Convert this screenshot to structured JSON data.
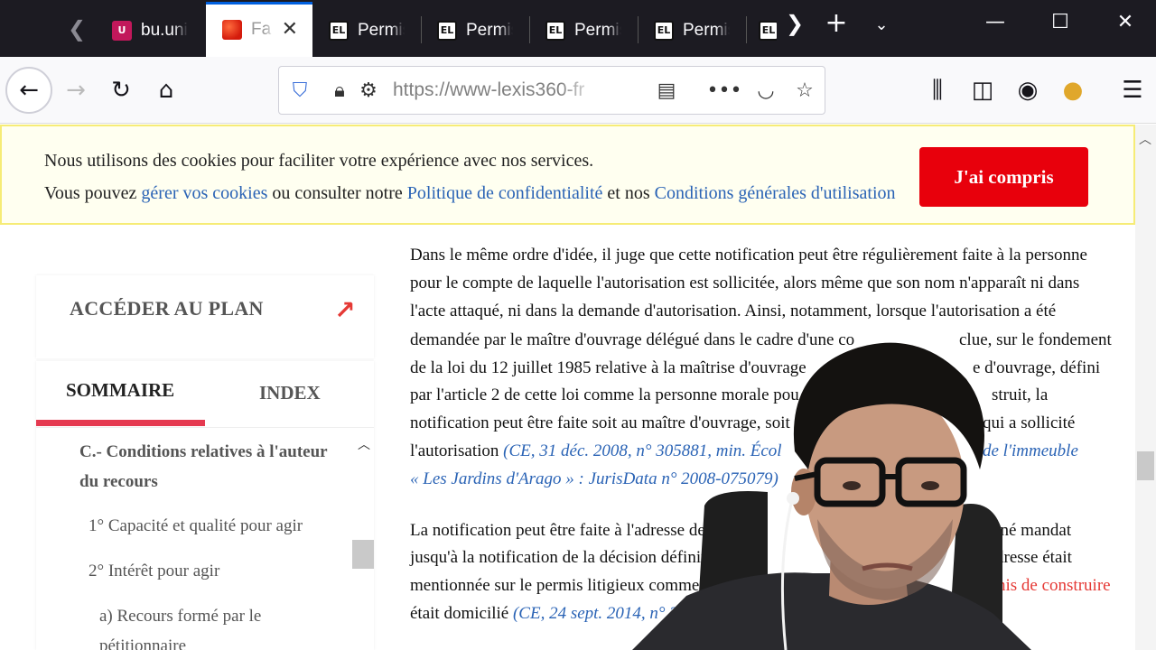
{
  "browser": {
    "tabs": [
      {
        "title": "bu.uni",
        "favicon": "U",
        "active": false
      },
      {
        "title": "Fa",
        "favicon": "",
        "active": true
      },
      {
        "title": "Permis",
        "favicon": "EL",
        "active": false
      },
      {
        "title": "Permis",
        "favicon": "EL",
        "active": false
      },
      {
        "title": "Permis",
        "favicon": "EL",
        "active": false
      },
      {
        "title": "Permis",
        "favicon": "EL",
        "active": false
      },
      {
        "title": "",
        "favicon": "EL",
        "active": false
      }
    ],
    "url": "https://www-lexis360-fr",
    "icons": {
      "back": "back-arrow-icon",
      "forward": "forward-arrow-icon",
      "reload": "reload-icon",
      "home": "home-icon",
      "shield": "tracking-shield-icon",
      "lock": "lock-icon",
      "permissions": "permissions-icon",
      "reader": "reader-view-icon",
      "more": "more-actions-icon",
      "pocket": "pocket-icon",
      "bookmark": "bookmark-star-icon",
      "library": "library-icon",
      "sidebar": "sidebar-icon",
      "account": "account-icon",
      "extension": "extension-icon",
      "menu": "hamburger-menu-icon"
    },
    "colors": {
      "tabbar": "#1c1b22",
      "active_tab_accent": "#0060df"
    }
  },
  "cookie_banner": {
    "line1": "Nous utilisons des cookies pour faciliter votre expérience avec nos services.",
    "line2_prefix": "Vous pouvez ",
    "manage_link": "gérer vos cookies",
    "line2_mid": " ou consulter notre ",
    "privacy_link": "Politique de confidentialité",
    "line2_and": " et nos ",
    "terms_link": "Conditions générales d'utilisation",
    "accept_button": "J'ai compris",
    "colors": {
      "background": "#fffff0",
      "border": "#f6ec76",
      "button": "#e8000c",
      "link": "#2a63b5"
    }
  },
  "sidebar": {
    "plan_label": "ACCÉDER AU PLAN",
    "tabs": {
      "sommaire": "SOMMAIRE",
      "index": "INDEX"
    },
    "toc": {
      "section_title": "C.- Conditions relatives à l'auteur du recours",
      "items": [
        "1° Capacité et qualité pour agir",
        "2° Intérêt pour agir",
        "a) Recours formé par le pétitionnaire"
      ]
    },
    "accent_color": "#e53950"
  },
  "article": {
    "lines": [
      " Dans le même ordre d'idée, il juge que cette notification peut être régulièrement faite à la personne",
      "pour le compte de laquelle l'autorisation est sollicitée, alors même que son nom n'apparaît ni dans",
      "l'acte attaqué, ni dans la demande d'autorisation. Ainsi, notamment, lorsque l'autorisation a été",
      "demandée par le maître d'ouvrage délégué dans le cadre d'une co",
      "de la loi du 12 juillet 1985 relative à la maîtrise d'ouvrage",
      "par l'article 2 de cette loi comme la personne morale pou",
      "notification peut être faite soit au maître d'ouvrage, soit",
      "l'autorisation"
    ],
    "line4_tail": "clue, sur le fondement",
    "line5_tail": "e d'ouvrage, défini",
    "line6_tail": "struit, la",
    "line7_tail": "qui a sollicité",
    "cite1": " (CE, 31 déc. 2008, n° 305881, min. Écol",
    "cite1_tail": "de l'immeuble",
    "cite2": "« Les Jardins d'Arago » :  JurisData n° 2008-075079)",
    "p2_lines": [
      " La notification peut être faite à l'adresse de",
      "jusqu'à la notification de la décision définit",
      "mentionnée sur le permis litigieux comme",
      "était domicilié"
    ],
    "p2_line1_tail": "nné mandat",
    "p2_line2_tail": "dresse était",
    "p2_line3_tail": "nis de construire",
    "cite3": " (CE, 24 sept. 2014, n° 3",
    "colors": {
      "citation": "#2a63b5",
      "link_red": "#e53935"
    }
  }
}
